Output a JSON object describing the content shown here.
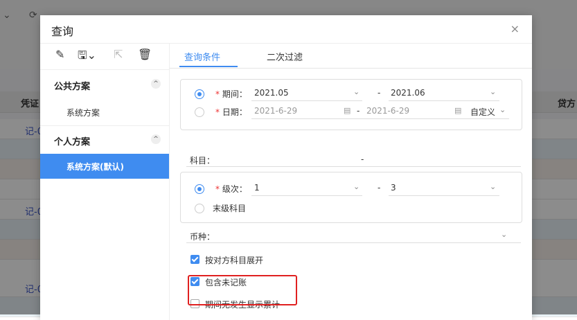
{
  "background": {
    "toolbar_items": [
      "⌄",
      "⟳"
    ],
    "table_headers": {
      "col_voucher": "凭证",
      "col_credit": "贷方"
    },
    "link_text": "记-0"
  },
  "dialog": {
    "title": "查询",
    "close_glyph": "×"
  },
  "left_toolbar": {
    "edit_icon": "✎",
    "save_icon": "🖫⌄",
    "export_icon": "⇱",
    "delete_icon": "🗑"
  },
  "schemes": {
    "public_group": "公共方案",
    "public_items": [
      "系统方案"
    ],
    "personal_group": "个人方案",
    "personal_items": [
      "系统方案(默认)"
    ],
    "collapse_glyph": "^"
  },
  "tabs": [
    "查询条件",
    "二次过滤"
  ],
  "period": {
    "label": "期间：",
    "from": "2021.05",
    "to": "2021.06",
    "dash": "-",
    "selected": true
  },
  "date": {
    "label": "日期：",
    "from": "2021-6-29",
    "to": "2021-6-29",
    "dash": "-",
    "mode": "自定义",
    "selected": false
  },
  "subject": {
    "label": "科目：",
    "dash": "-"
  },
  "level": {
    "label": "级次：",
    "from": "1",
    "to": "3",
    "dash": "-",
    "selected": true,
    "leaf_label": "末级科目",
    "leaf_selected": false
  },
  "currency": {
    "label": "币种："
  },
  "options": [
    {
      "label": "按对方科目展开",
      "checked": true
    },
    {
      "label": "包含未记账",
      "checked": true
    },
    {
      "label": "期间无发生显示累计",
      "checked": false
    }
  ],
  "required_mark": "*",
  "chevron_glyph": "⌄",
  "calendar_glyph": "▤",
  "colors": {
    "accent": "#3f8cf0",
    "highlight": "#e02020"
  }
}
